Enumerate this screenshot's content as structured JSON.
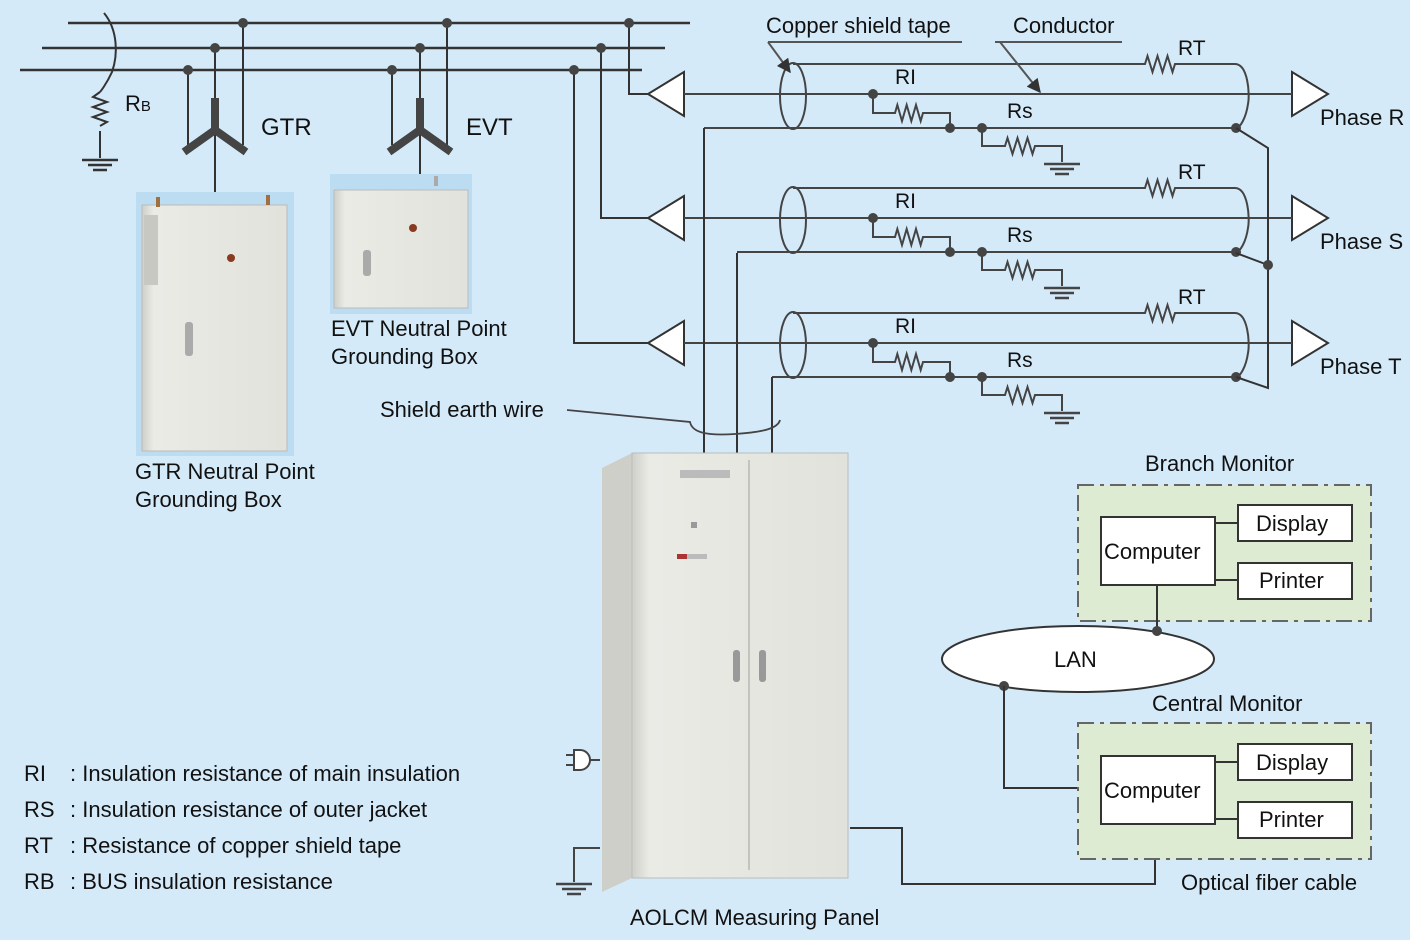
{
  "transformers": {
    "gtr_label": "GTR",
    "evt_label": "EVT"
  },
  "bus": {
    "rb_label_main": "R",
    "rb_label_sub": "B"
  },
  "equipment": {
    "gtr_box_line1": "GTR Neutral Point",
    "gtr_box_line2": "Grounding Box",
    "evt_box_line1": "EVT Neutral Point",
    "evt_box_line2": "Grounding Box",
    "measuring_panel": "AOLCM Measuring Panel",
    "shield_earth_wire": "Shield earth wire"
  },
  "cable": {
    "copper_shield_tape": "Copper shield tape",
    "conductor": "Conductor",
    "phases": [
      {
        "label": "Phase R",
        "ri": "RI",
        "rs": "Rs",
        "rt": "RT"
      },
      {
        "label": "Phase S",
        "ri": "RI",
        "rs": "Rs",
        "rt": "RT"
      },
      {
        "label": "Phase T",
        "ri": "RI",
        "rs": "Rs",
        "rt": "RT"
      }
    ]
  },
  "network": {
    "branch_monitor": {
      "title": "Branch Monitor",
      "computer": "Computer",
      "display": "Display",
      "printer": "Printer"
    },
    "central_monitor": {
      "title": "Central Monitor",
      "computer": "Computer",
      "display": "Display",
      "printer": "Printer"
    },
    "lan": "LAN",
    "optical_fiber": "Optical fiber cable"
  },
  "legend": [
    {
      "key": "RI",
      "text": ": Insulation resistance of main insulation"
    },
    {
      "key": "RS",
      "text": ": Insulation resistance of outer jacket"
    },
    {
      "key": "RT",
      "text": ": Resistance of copper shield tape"
    },
    {
      "key": "RB",
      "text": ": BUS insulation resistance"
    }
  ],
  "colors": {
    "background": "#d5eaf9",
    "line": "#333333",
    "monitor_fill": "#dcebd1",
    "cabinet": "#e6e6e0"
  }
}
